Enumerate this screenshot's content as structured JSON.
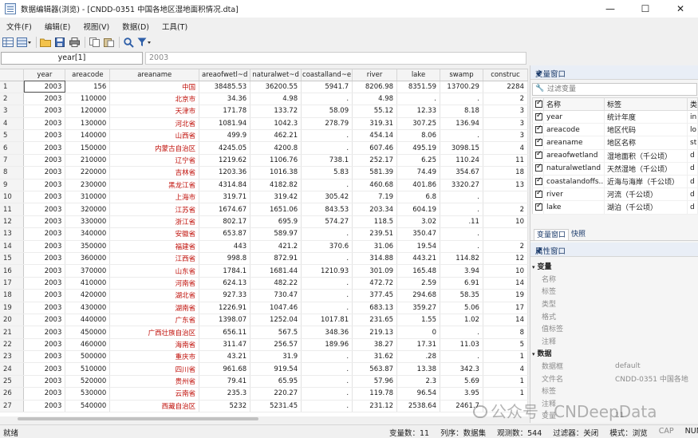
{
  "window": {
    "title": "数据编辑器(浏览) - [CNDD-0351 中国各地区湿地面积情况.dta]",
    "minimize": "—",
    "maximize": "☐",
    "close": "✕"
  },
  "menu": [
    "文件(F)",
    "编辑(E)",
    "视图(V)",
    "数据(D)",
    "工具(T)"
  ],
  "toolbar": {
    "icons": [
      "grid-view-icon",
      "grid-dropdown-icon",
      "open-folder-icon",
      "save-icon",
      "print-icon",
      "copy-icon",
      "paste-icon",
      "search-icon",
      "filter-icon"
    ]
  },
  "cellbar": {
    "varref": "year[1]",
    "value": "2003"
  },
  "grid": {
    "columns": [
      "year",
      "areacode",
      "areaname",
      "areaofwetl~d",
      "naturalwet~d",
      "coastalland~e",
      "river",
      "lake",
      "swamp",
      "construc"
    ],
    "rows": [
      [
        "1",
        "2003",
        "156",
        "中国",
        "38485.53",
        "36200.55",
        "5941.7",
        "8206.98",
        "8351.59",
        "13700.29",
        "2284"
      ],
      [
        "2",
        "2003",
        "110000",
        "北京市",
        "34.36",
        "4.98",
        ".",
        "4.98",
        ".",
        ".",
        "2"
      ],
      [
        "3",
        "2003",
        "120000",
        "天津市",
        "171.78",
        "133.72",
        "58.09",
        "55.12",
        "12.33",
        "8.18",
        "3"
      ],
      [
        "4",
        "2003",
        "130000",
        "河北省",
        "1081.94",
        "1042.3",
        "278.79",
        "319.31",
        "307.25",
        "136.94",
        "3"
      ],
      [
        "5",
        "2003",
        "140000",
        "山西省",
        "499.9",
        "462.21",
        ".",
        "454.14",
        "8.06",
        ".",
        "3"
      ],
      [
        "6",
        "2003",
        "150000",
        "内蒙古自治区",
        "4245.05",
        "4200.8",
        ".",
        "607.46",
        "495.19",
        "3098.15",
        "4"
      ],
      [
        "7",
        "2003",
        "210000",
        "辽宁省",
        "1219.62",
        "1106.76",
        "738.1",
        "252.17",
        "6.25",
        "110.24",
        "11"
      ],
      [
        "8",
        "2003",
        "220000",
        "吉林省",
        "1203.36",
        "1016.38",
        "5.83",
        "581.39",
        "74.49",
        "354.67",
        "18"
      ],
      [
        "9",
        "2003",
        "230000",
        "黑龙江省",
        "4314.84",
        "4182.82",
        ".",
        "460.68",
        "401.86",
        "3320.27",
        "13"
      ],
      [
        "10",
        "2003",
        "310000",
        "上海市",
        "319.71",
        "319.42",
        "305.42",
        "7.19",
        "6.8",
        ".",
        ""
      ],
      [
        "11",
        "2003",
        "320000",
        "江苏省",
        "1674.67",
        "1651.06",
        "843.53",
        "203.34",
        "604.19",
        ".",
        "2"
      ],
      [
        "12",
        "2003",
        "330000",
        "浙江省",
        "802.17",
        "695.9",
        "574.27",
        "118.5",
        "3.02",
        ".11",
        "10"
      ],
      [
        "13",
        "2003",
        "340000",
        "安徽省",
        "653.87",
        "589.97",
        ".",
        "239.51",
        "350.47",
        ".",
        ""
      ],
      [
        "14",
        "2003",
        "350000",
        "福建省",
        "443",
        "421.2",
        "370.6",
        "31.06",
        "19.54",
        ".",
        "2"
      ],
      [
        "15",
        "2003",
        "360000",
        "江西省",
        "998.8",
        "872.91",
        ".",
        "314.88",
        "443.21",
        "114.82",
        "12"
      ],
      [
        "16",
        "2003",
        "370000",
        "山东省",
        "1784.1",
        "1681.44",
        "1210.93",
        "301.09",
        "165.48",
        "3.94",
        "10"
      ],
      [
        "17",
        "2003",
        "410000",
        "河南省",
        "624.13",
        "482.22",
        ".",
        "472.72",
        "2.59",
        "6.91",
        "14"
      ],
      [
        "18",
        "2003",
        "420000",
        "湖北省",
        "927.33",
        "730.47",
        ".",
        "377.45",
        "294.68",
        "58.35",
        "19"
      ],
      [
        "19",
        "2003",
        "430000",
        "湖南省",
        "1226.91",
        "1047.46",
        ".",
        "683.13",
        "359.27",
        "5.06",
        "17"
      ],
      [
        "20",
        "2003",
        "440000",
        "广东省",
        "1398.07",
        "1252.04",
        "1017.81",
        "231.65",
        "1.55",
        "1.02",
        "14"
      ],
      [
        "21",
        "2003",
        "450000",
        "广西壮族自治区",
        "656.11",
        "567.5",
        "348.36",
        "219.13",
        "0",
        ".",
        "8"
      ],
      [
        "22",
        "2003",
        "460000",
        "海南省",
        "311.47",
        "256.57",
        "189.96",
        "38.27",
        "17.31",
        "11.03",
        "5"
      ],
      [
        "23",
        "2003",
        "500000",
        "重庆市",
        "43.21",
        "31.9",
        ".",
        "31.62",
        ".28",
        ".",
        "1"
      ],
      [
        "24",
        "2003",
        "510000",
        "四川省",
        "961.68",
        "919.54",
        ".",
        "563.87",
        "13.38",
        "342.3",
        "4"
      ],
      [
        "25",
        "2003",
        "520000",
        "贵州省",
        "79.41",
        "65.95",
        ".",
        "57.96",
        "2.3",
        "5.69",
        "1"
      ],
      [
        "26",
        "2003",
        "530000",
        "云南省",
        "235.3",
        "220.27",
        ".",
        "119.78",
        "96.54",
        "3.95",
        "1"
      ],
      [
        "27",
        "2003",
        "540000",
        "西藏自治区",
        "5232",
        "5231.45",
        ".",
        "231.12",
        "2538.64",
        "2461.7",
        ""
      ]
    ]
  },
  "varpane": {
    "title": "变量窗口",
    "pin": "🖈",
    "filter_placeholder": "过滤变量",
    "headers": [
      "名称",
      "标签",
      "类"
    ],
    "vars": [
      [
        "year",
        "统计年度",
        "in"
      ],
      [
        "areacode",
        "地区代码",
        "lo"
      ],
      [
        "areaname",
        "地区名称",
        "st"
      ],
      [
        "areaofwetland",
        "湿地面积（千公顷）",
        "d"
      ],
      [
        "naturalwetland",
        "天然湿地（千公顷）",
        "d"
      ],
      [
        "coastalandoffs...",
        "近海与海岸（千公顷）",
        "d"
      ],
      [
        "river",
        "河流（千公顷）",
        "d"
      ],
      [
        "lake",
        "湖泊（千公顷）",
        "d"
      ]
    ],
    "tabs": [
      "变量窗口",
      "快照"
    ]
  },
  "proppane": {
    "title": "属性窗口",
    "pin": "🖈",
    "groups": [
      {
        "name": "变量",
        "items": [
          [
            "名称",
            ""
          ],
          [
            "标签",
            ""
          ],
          [
            "类型",
            ""
          ],
          [
            "格式",
            ""
          ],
          [
            "值标签",
            ""
          ],
          [
            "注释",
            ""
          ]
        ]
      },
      {
        "name": "数据",
        "items": [
          [
            "数据框",
            "default"
          ],
          [
            "文件名",
            "CNDD-0351 中国各地"
          ],
          [
            "标签",
            ""
          ],
          [
            "注释",
            ""
          ],
          [
            "变量",
            "11"
          ]
        ]
      }
    ]
  },
  "watermark": "公众号 · CNDeepData",
  "status": {
    "ready": "就绪",
    "vars": "变量数：11",
    "order": "列序：数据集",
    "obs": "观测数：544",
    "filter": "过滤器：关闭",
    "mode": "模式：浏览",
    "cap": "CAP",
    "num": "NUM"
  }
}
